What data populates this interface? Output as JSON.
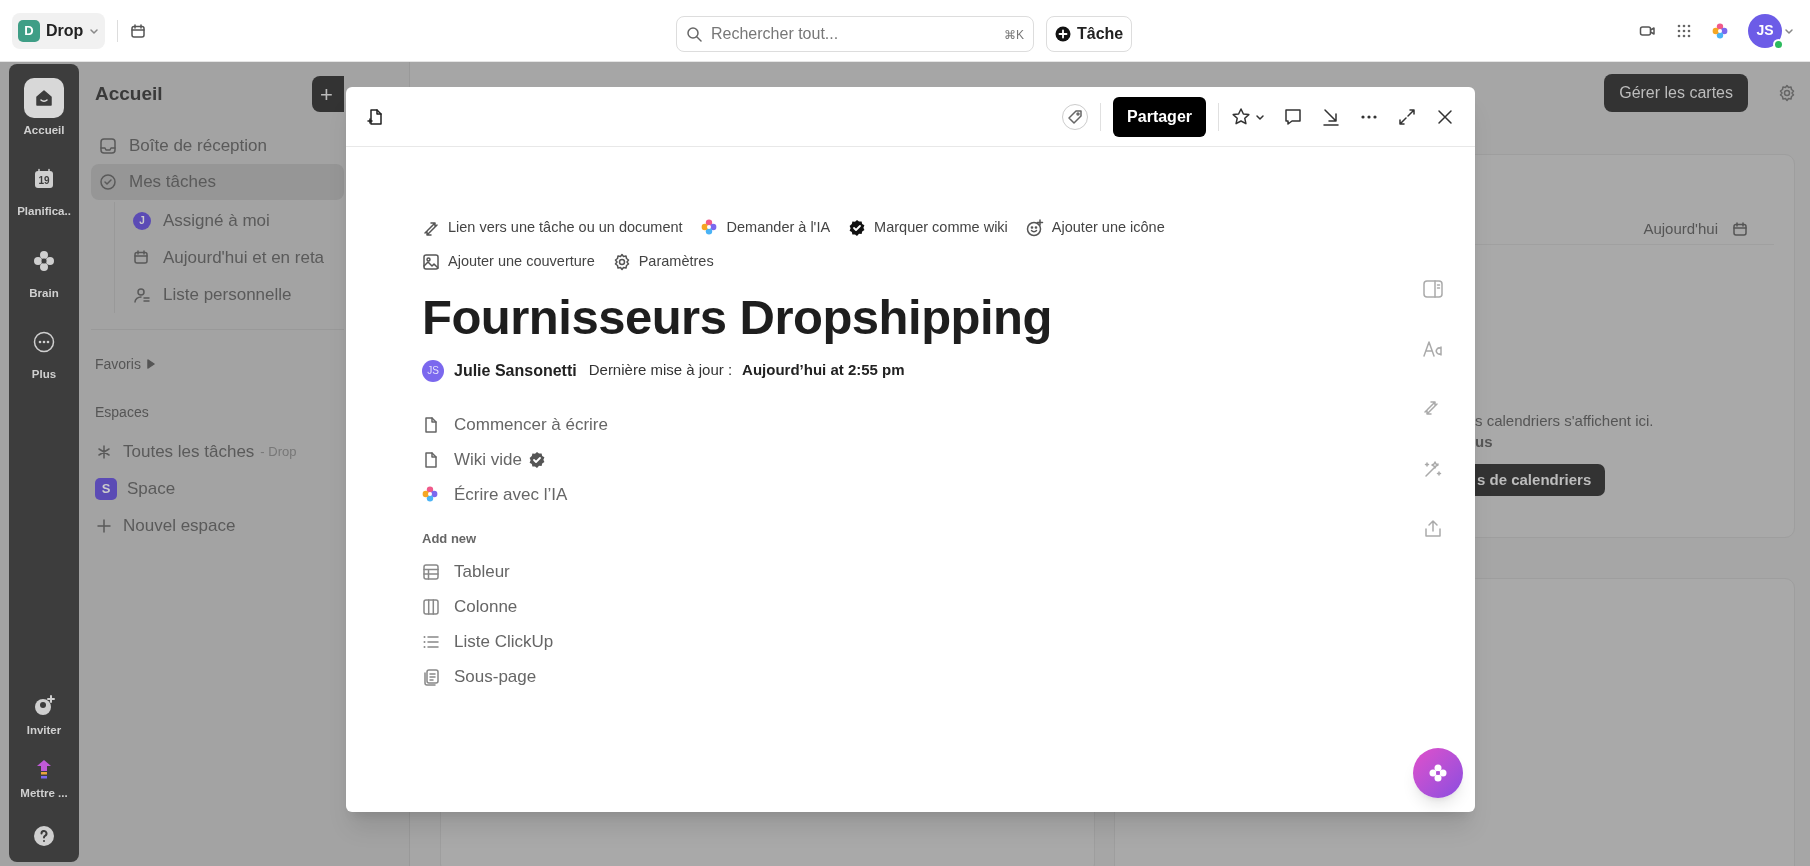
{
  "top_bar": {
    "workspace": {
      "badge": "D",
      "name": "Drop"
    },
    "search": {
      "placeholder": "Rechercher tout...",
      "shortcut": "⌘K"
    },
    "new_task_button": "Tâche",
    "avatar": "JS"
  },
  "rail": {
    "items": [
      {
        "label": "Accueil",
        "selected": true
      },
      {
        "label": "Planifica..",
        "selected": false
      },
      {
        "label": "Brain",
        "selected": false
      },
      {
        "label": "Plus",
        "selected": false
      }
    ],
    "bottom_items": [
      "Inviter",
      "Mettre ..."
    ],
    "calendar_day": "19"
  },
  "sidebar": {
    "title": "Accueil",
    "add_button": "+",
    "items": [
      {
        "label": "Boîte de réception",
        "selected": false
      },
      {
        "label": "Mes tâches",
        "selected": true,
        "children": [
          {
            "label": "Assigné à moi",
            "badge": "J"
          },
          {
            "label": "Aujourd'hui et en reta"
          },
          {
            "label": "Liste personnelle"
          }
        ]
      }
    ],
    "favorites": "Favoris",
    "spaces_heading": "Espaces",
    "spaces": [
      {
        "label": "Toutes les tâches",
        "suffix": "- Drop"
      },
      {
        "label": "Space",
        "badge": "S"
      },
      {
        "label": "Nouvel espace"
      }
    ]
  },
  "main": {
    "manage_button": "Gérer les cartes",
    "date_label": "Aujourd'hui",
    "calendar_lines": [
      "s calendriers s'affichent ici.",
      "us"
    ],
    "calendar_button": "s de calendriers"
  },
  "modal": {
    "share_button": "Partager",
    "actions": [
      {
        "label": "Lien vers une tâche ou un document"
      },
      {
        "label": "Demander à l'IA"
      },
      {
        "label": "Marquer comme wiki"
      },
      {
        "label": "Ajouter une icône"
      },
      {
        "label": "Ajouter une couverture"
      },
      {
        "label": "Paramètres"
      }
    ],
    "title": "Fournisseurs Dropshipping",
    "author": {
      "initials": "JS",
      "name": "Julie Sansonetti"
    },
    "updated_label": "Dernière mise à jour :",
    "updated_value": "Aujourd’hui at 2:55 pm",
    "start_items": [
      {
        "label": "Commencer à écrire",
        "verified": false
      },
      {
        "label": "Wiki vide",
        "verified": true
      },
      {
        "label": "Écrire avec l’IA",
        "verified": false
      }
    ],
    "add_new_heading": "Add new",
    "add_new_items": [
      {
        "label": "Tableur"
      },
      {
        "label": "Colonne"
      },
      {
        "label": "Liste ClickUp"
      },
      {
        "label": "Sous-page"
      }
    ]
  }
}
